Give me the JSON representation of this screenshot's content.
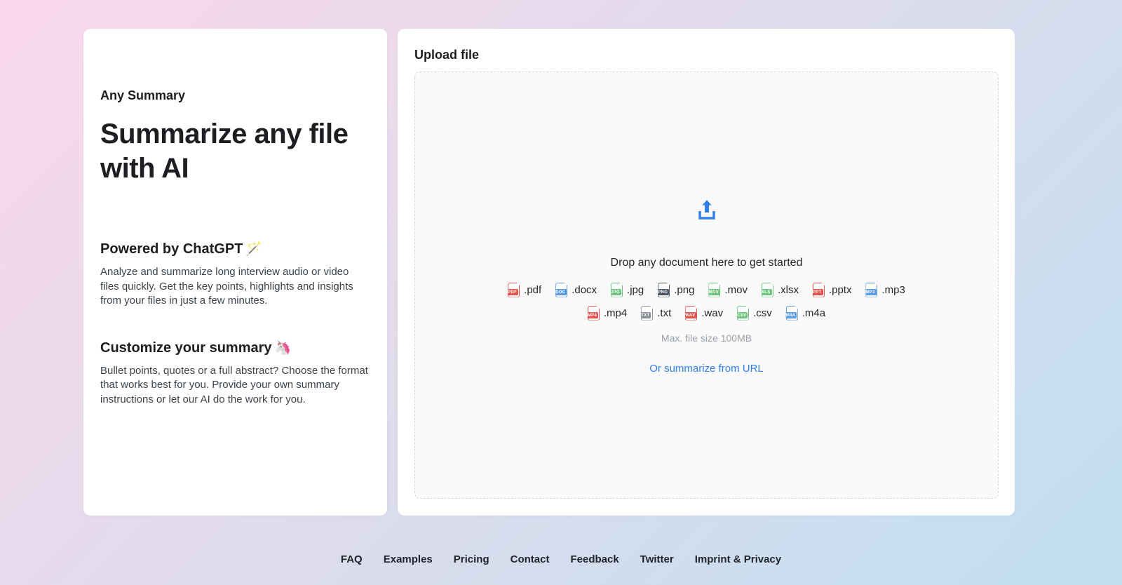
{
  "background": {
    "gradient_start": "#fbd7ec",
    "gradient_mid": "#dddcec",
    "gradient_end": "#bfdff1"
  },
  "left_card": {
    "brand": "Any Summary",
    "headline": "Summarize any file with AI",
    "sections": [
      {
        "title": "Powered by ChatGPT",
        "emoji": "🪄",
        "body": "Analyze and summarize long interview audio or video files quickly. Get the key points, highlights and insights from your files in just a few minutes."
      },
      {
        "title": "Customize your summary",
        "emoji": "🦄",
        "body": "Bullet points, quotes or a full abstract? Choose the format that works best for you. Provide your own summary instructions or let our AI do the work for you."
      }
    ]
  },
  "upload": {
    "title": "Upload file",
    "icon_color": "#2f80ed",
    "drop_text": "Drop any document here to get started",
    "row1": [
      {
        "label": ".pdf",
        "badge": "PDF",
        "color": "#e5534b"
      },
      {
        "label": ".docx",
        "badge": "DOC",
        "color": "#5c9ce6"
      },
      {
        "label": ".jpg",
        "badge": "JPG",
        "color": "#6fc47e"
      },
      {
        "label": ".png",
        "badge": "PNG",
        "color": "#4d5560"
      },
      {
        "label": ".mov",
        "badge": "MOV",
        "color": "#6fc47e"
      },
      {
        "label": ".xlsx",
        "badge": "XLS",
        "color": "#6fc47e"
      },
      {
        "label": ".pptx",
        "badge": "PPT",
        "color": "#e5534b"
      },
      {
        "label": ".mp3",
        "badge": "MP3",
        "color": "#5c9ce6"
      }
    ],
    "row2": [
      {
        "label": ".mp4",
        "badge": "MP4",
        "color": "#e5534b"
      },
      {
        "label": ".txt",
        "badge": "TXT",
        "color": "#8a9099"
      },
      {
        "label": ".wav",
        "badge": "WAV",
        "color": "#e5534b"
      },
      {
        "label": ".csv",
        "badge": "CSV",
        "color": "#6fc47e"
      },
      {
        "label": ".m4a",
        "badge": "M4A",
        "color": "#5c9ce6"
      }
    ],
    "max_size": "Max. file size 100MB",
    "url_link": "Or summarize from URL",
    "link_color": "#2f80ed"
  },
  "footer": {
    "links": [
      {
        "label": "FAQ"
      },
      {
        "label": "Examples"
      },
      {
        "label": "Pricing"
      },
      {
        "label": "Contact"
      },
      {
        "label": "Feedback"
      },
      {
        "label": "Twitter"
      },
      {
        "label": "Imprint & Privacy"
      }
    ]
  }
}
